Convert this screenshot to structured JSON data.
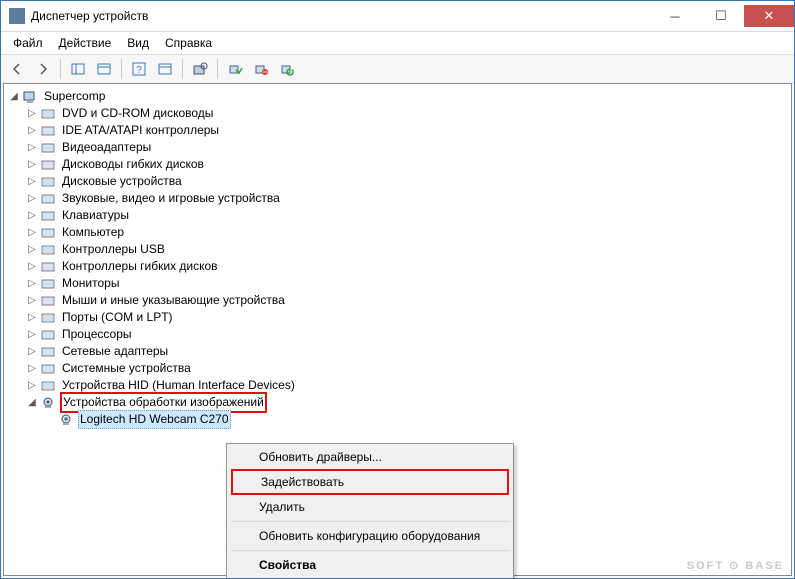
{
  "window": {
    "title": "Диспетчер устройств"
  },
  "menu": {
    "file": "Файл",
    "action": "Действие",
    "view": "Вид",
    "help": "Справка"
  },
  "tree": {
    "root": "Supercomp",
    "items": [
      {
        "label": "DVD и CD-ROM дисководы"
      },
      {
        "label": "IDE ATA/ATAPI контроллеры"
      },
      {
        "label": "Видеоадаптеры"
      },
      {
        "label": "Дисководы гибких дисков"
      },
      {
        "label": "Дисковые устройства"
      },
      {
        "label": "Звуковые, видео и игровые устройства"
      },
      {
        "label": "Клавиатуры"
      },
      {
        "label": "Компьютер"
      },
      {
        "label": "Контроллеры USB"
      },
      {
        "label": "Контроллеры гибких дисков"
      },
      {
        "label": "Мониторы"
      },
      {
        "label": "Мыши и иные указывающие устройства"
      },
      {
        "label": "Порты (COM и LPT)"
      },
      {
        "label": "Процессоры"
      },
      {
        "label": "Сетевые адаптеры"
      },
      {
        "label": "Системные устройства"
      },
      {
        "label": "Устройства HID (Human Interface Devices)"
      }
    ],
    "imaging": {
      "label": "Устройства обработки изображений",
      "device": "Logitech HD Webcam C270"
    }
  },
  "context": {
    "update": "Обновить драйверы...",
    "enable": "Задействовать",
    "delete": "Удалить",
    "scan": "Обновить конфигурацию оборудования",
    "properties": "Свойства"
  },
  "watermark": "SOFT ⊙ BASE"
}
